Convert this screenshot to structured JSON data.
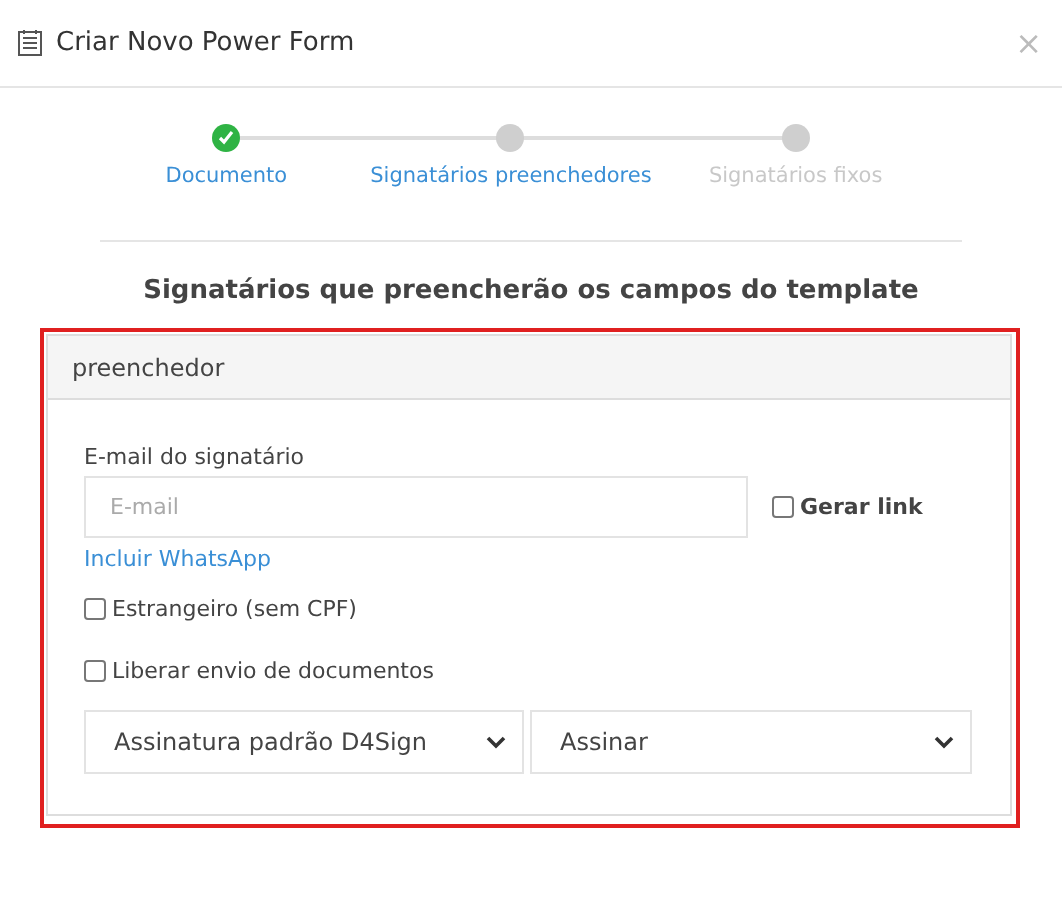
{
  "window": {
    "title": "Criar Novo Power Form",
    "close": "×"
  },
  "steps": [
    {
      "label": "Documento",
      "completed": true,
      "reached": true
    },
    {
      "label": "Signatários preenchedores",
      "completed": false,
      "reached": true
    },
    {
      "label": "Signatários fixos",
      "completed": false,
      "reached": false
    }
  ],
  "heading": "Signatários que preencherão os campos do template",
  "panel": {
    "title": "preenchedor",
    "highlighted": true,
    "email_label": "E-mail do signatário",
    "email": {
      "placeholder": "E-mail"
    },
    "generate_link": {
      "label": "Gerar link",
      "checked": false
    },
    "whatsapp_link": "Incluir WhatsApp",
    "options": [
      {
        "label": "Estrangeiro (sem CPF)",
        "checked": false
      },
      {
        "label": "Liberar envio de documentos",
        "checked": false
      }
    ],
    "selects": [
      "Assinatura padrão D4Sign",
      "Assinar"
    ]
  }
}
